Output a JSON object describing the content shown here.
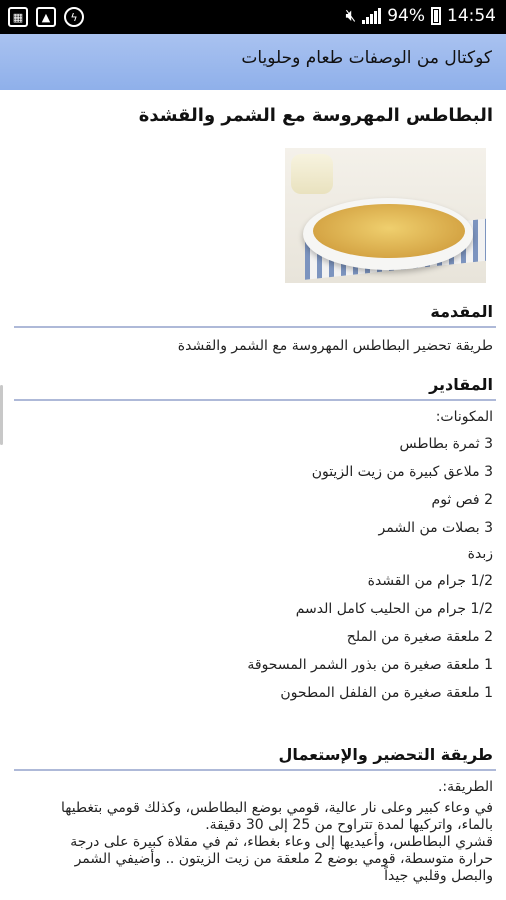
{
  "status": {
    "battery": "94%",
    "time": "14:54"
  },
  "appbar": {
    "title": "كوكتال من الوصفات طعام وحلويات"
  },
  "recipe": {
    "title": "البطاطس المهروسة مع الشمر والقشدة",
    "intro_heading": "المقدمة",
    "intro_text": "طريقة تحضير البطاطس المهروسة مع الشمر والقشدة",
    "ingredients_heading": "المقادير",
    "ingredients_label": "المكونات:",
    "ingredients": [
      "3 ثمرة بطاطس",
      "3 ملاعق كبيرة من زيت الزيتون",
      "2 فص ثوم",
      "3 بصلات من الشمر",
      "زبدة",
      "1/2 جرام من القشدة",
      "1/2 جرام من الحليب كامل الدسم",
      "2 ملعقة صغيرة من الملح",
      "1 ملعقة صغيرة من بذور الشمر المسحوقة",
      "1 ملعقة صغيرة من الفلفل المطحون"
    ],
    "method_heading": "طريقة التحضير والإستعمال",
    "method_label": "الطريقة:.",
    "method_lines": [
      "في وعاء كبير وعلى نار عالية، قومي بوضع البطاطس، وكذلك قومي بتغطيها",
      "بالماء، واتركيها لمدة تتراوح من 25 إلى 30 دقيقة.",
      "قشري البطاطس، وأعيديها إلى وعاء بغطاء، ثم في مقلاة كبيرة على درجة",
      "حرارة متوسطة، قومي بوضع 2 ملعقة من زيت الزيتون .. وأضيفي الشمر",
      "والبصل وقلبي جيداً"
    ]
  },
  "icons": [
    "gallery-icon",
    "image-icon",
    "messenger-icon",
    "mute-icon",
    "signal-icon",
    "battery-icon"
  ]
}
